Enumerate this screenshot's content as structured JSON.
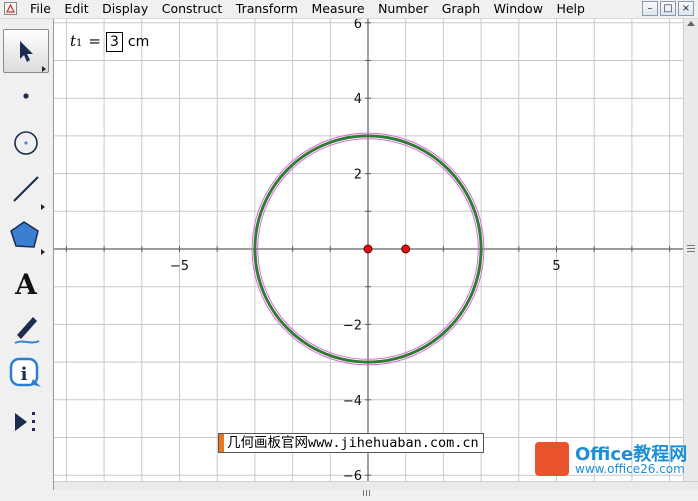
{
  "menubar": {
    "items": [
      "File",
      "Edit",
      "Display",
      "Construct",
      "Transform",
      "Measure",
      "Number",
      "Graph",
      "Window",
      "Help"
    ],
    "window_buttons": [
      "–",
      "□",
      "×"
    ]
  },
  "toolbox": {
    "tools": [
      "arrow-select-icon",
      "point-tool-icon",
      "compass-tool-icon",
      "straightedge-tool-icon",
      "polygon-tool-icon",
      "text-tool-icon",
      "marker-tool-icon",
      "information-tool-icon",
      "custom-tool-icon"
    ],
    "text_glyph": "A",
    "info_glyph": "i"
  },
  "parameter": {
    "name": "t",
    "subscript": "1",
    "equals": "=",
    "value": "3",
    "unit": "cm"
  },
  "graph": {
    "x_ticks": [
      "−5",
      "5"
    ],
    "y_ticks": [
      "6",
      "4",
      "2",
      "−2",
      "−4",
      "−6"
    ],
    "circle_radius": 3,
    "center_point": [
      0,
      0
    ],
    "second_point": [
      1,
      0
    ],
    "colors": {
      "circle_outer": "#dd66dd",
      "circle_main": "#2e7d32",
      "point": "#dd1111",
      "grid": "#c8c8c8",
      "axis": "#606060"
    }
  },
  "watermark": {
    "text": "几何画板官网www.jihehuaban.com.cn"
  },
  "logo": {
    "title": "Office教程网",
    "url": "www.office26.com"
  }
}
